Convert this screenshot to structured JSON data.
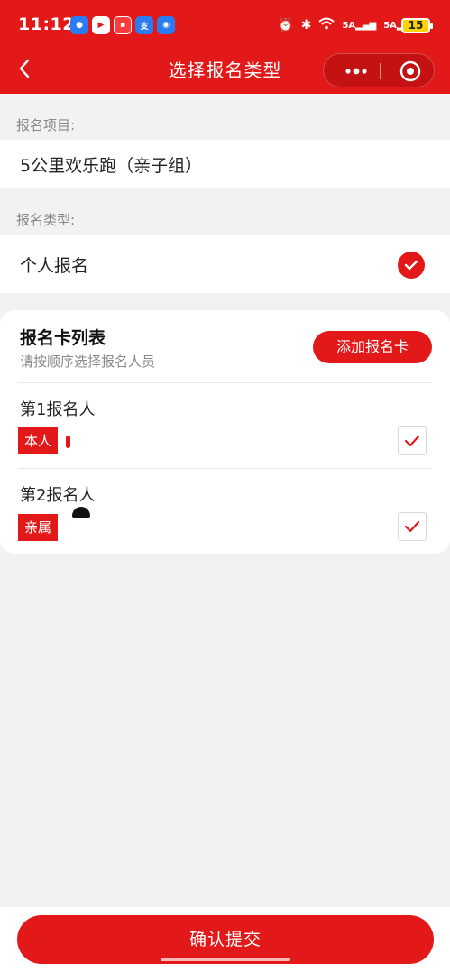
{
  "status_bar": {
    "time": "11:12",
    "network_labels": [
      "5A",
      "5A"
    ],
    "battery": "15"
  },
  "nav": {
    "title": "选择报名类型"
  },
  "project": {
    "label": "报名项目:",
    "value": "5公里欢乐跑（亲子组）"
  },
  "registration_type": {
    "label": "报名类型:",
    "value": "个人报名",
    "selected": true
  },
  "card_list": {
    "title": "报名卡列表",
    "subtitle": "请按顺序选择报名人员",
    "add_button": "添加报名卡",
    "persons": [
      {
        "title": "第1报名人",
        "tag": "本人",
        "checked": true
      },
      {
        "title": "第2报名人",
        "tag": "亲属",
        "checked": true
      }
    ]
  },
  "submit": {
    "label": "确认提交"
  },
  "colors": {
    "brand_red": "#e31919",
    "background": "#f2f2f2"
  }
}
